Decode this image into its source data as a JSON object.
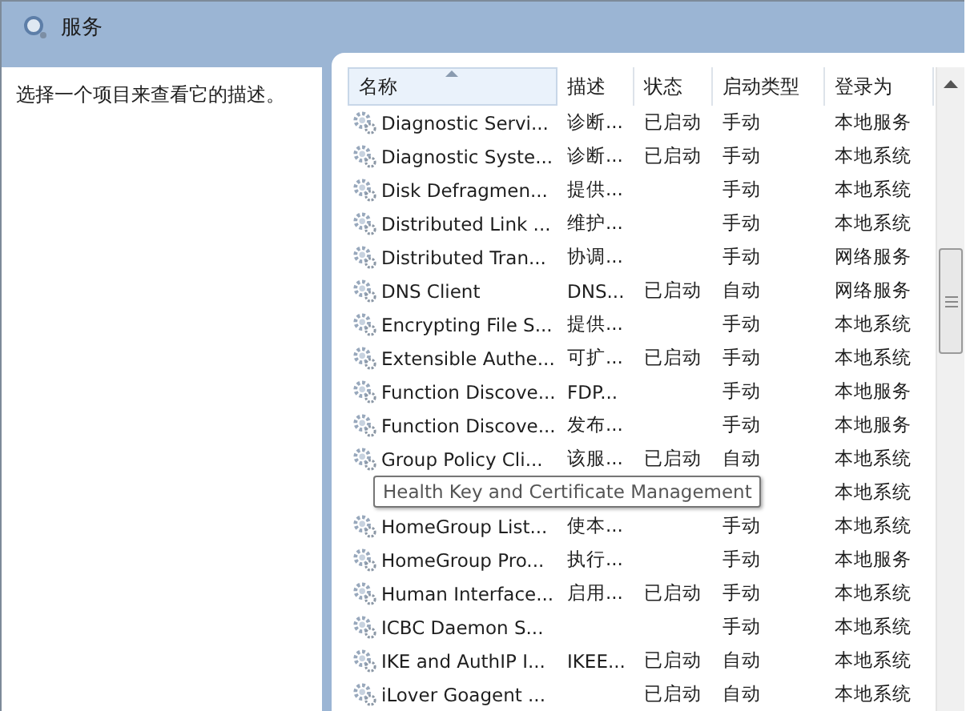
{
  "window": {
    "title": "服务"
  },
  "description_pane": {
    "text": "选择一个项目来查看它的描述。"
  },
  "table": {
    "columns": [
      {
        "label": "名称",
        "sorted": true
      },
      {
        "label": "描述",
        "sorted": false
      },
      {
        "label": "状态",
        "sorted": false
      },
      {
        "label": "启动类型",
        "sorted": false
      },
      {
        "label": "登录为",
        "sorted": false
      }
    ],
    "rows": [
      {
        "name": "Diagnostic Servi...",
        "description": "诊断...",
        "status": "已启动",
        "startup": "手动",
        "logon": "本地服务"
      },
      {
        "name": "Diagnostic Syste...",
        "description": "诊断...",
        "status": "已启动",
        "startup": "手动",
        "logon": "本地系统"
      },
      {
        "name": "Disk Defragmen...",
        "description": "提供...",
        "startup": "手动",
        "logon": "本地系统"
      },
      {
        "name": "Distributed Link ...",
        "description": "维护...",
        "startup": "手动",
        "logon": "本地系统"
      },
      {
        "name": "Distributed Tran...",
        "description": "协调...",
        "startup": "手动",
        "logon": "网络服务"
      },
      {
        "name": "DNS Client",
        "description": "DNS...",
        "status": "已启动",
        "startup": "自动",
        "logon": "网络服务"
      },
      {
        "name": "Encrypting File S...",
        "description": "提供...",
        "startup": "手动",
        "logon": "本地系统"
      },
      {
        "name": "Extensible Authe...",
        "description": "可扩...",
        "status": "已启动",
        "startup": "手动",
        "logon": "本地系统"
      },
      {
        "name": "Function Discove...",
        "description": "FDP...",
        "startup": "手动",
        "logon": "本地服务"
      },
      {
        "name": "Function Discove...",
        "description": "发布...",
        "startup": "手动",
        "logon": "本地服务"
      },
      {
        "name": "Group Policy Cli...",
        "description": "该服...",
        "status": "已启动",
        "startup": "自动",
        "logon": "本地系统"
      },
      {
        "logon": "本地系统",
        "tooltip": "Health Key and Certificate Management"
      },
      {
        "name": "HomeGroup List...",
        "description": "使本...",
        "startup": "手动",
        "logon": "本地系统"
      },
      {
        "name": "HomeGroup Pro...",
        "description": "执行...",
        "startup": "手动",
        "logon": "本地服务"
      },
      {
        "name": "Human Interface...",
        "description": "启用...",
        "status": "已启动",
        "startup": "手动",
        "logon": "本地系统"
      },
      {
        "name": "ICBC Daemon S...",
        "startup": "手动",
        "logon": "本地系统"
      },
      {
        "name": "IKE and AuthIP I...",
        "description": "IKEE...",
        "status": "已启动",
        "startup": "自动",
        "logon": "本地系统"
      },
      {
        "name": "iLover Goagent ...",
        "status": "已启动",
        "startup": "自动",
        "logon": "本地系统"
      }
    ]
  }
}
